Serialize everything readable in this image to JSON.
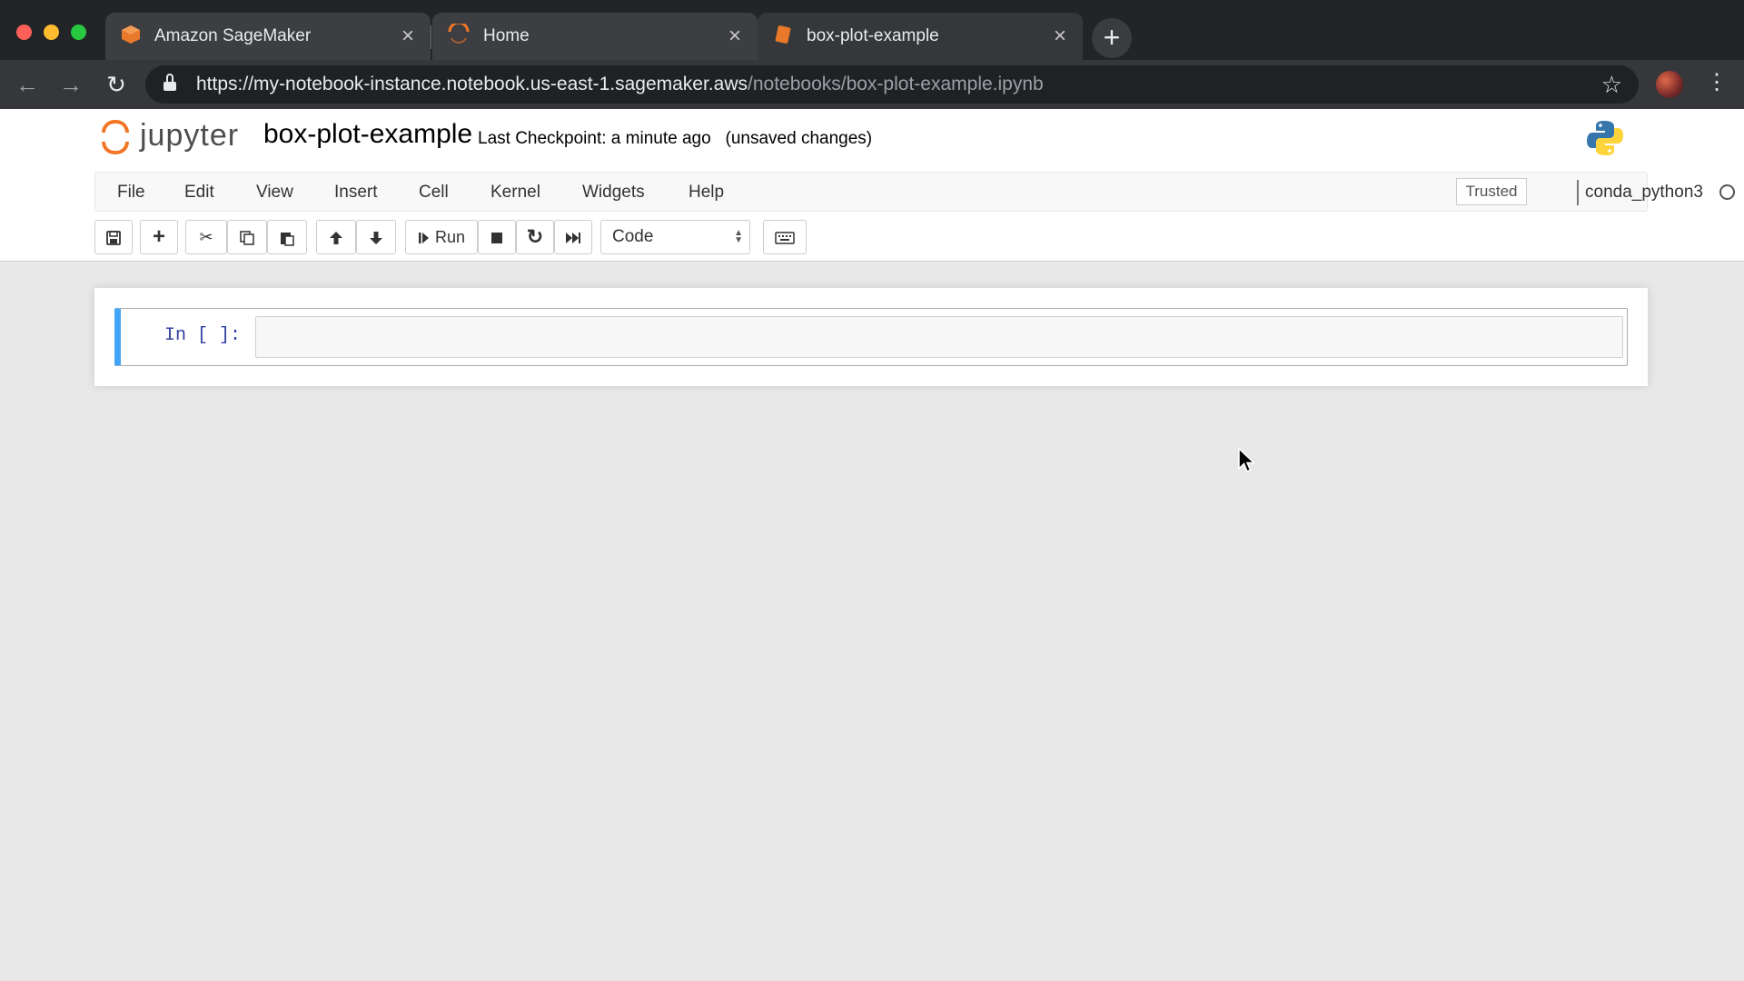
{
  "browser": {
    "tabs": [
      {
        "title": "Amazon SageMaker",
        "icon": "sagemaker-icon",
        "active": false
      },
      {
        "title": "Home",
        "icon": "jupyter-loading-icon",
        "active": false
      },
      {
        "title": "box-plot-example",
        "icon": "notebook-icon",
        "active": true
      }
    ],
    "url_host": "https://my-notebook-instance.notebook.us-east-1.sagemaker.aws",
    "url_path": "/notebooks/box-plot-example.ipynb"
  },
  "jupyter": {
    "logo_text": "jupyter",
    "notebook_name": "box-plot-example",
    "checkpoint_text": "Last Checkpoint: a minute ago",
    "save_status": "(unsaved changes)",
    "menu": [
      "File",
      "Edit",
      "View",
      "Insert",
      "Cell",
      "Kernel",
      "Widgets",
      "Help"
    ],
    "trusted_label": "Trusted",
    "kernel_name": "conda_python3",
    "toolbar": {
      "run_label": "Run",
      "cell_type": "Code"
    },
    "cell": {
      "prompt": "In [ ]:",
      "content": ""
    }
  },
  "colors": {
    "accent_orange": "#f37626",
    "cell_selected": "#42a5f5",
    "prompt": "#303f9f"
  }
}
